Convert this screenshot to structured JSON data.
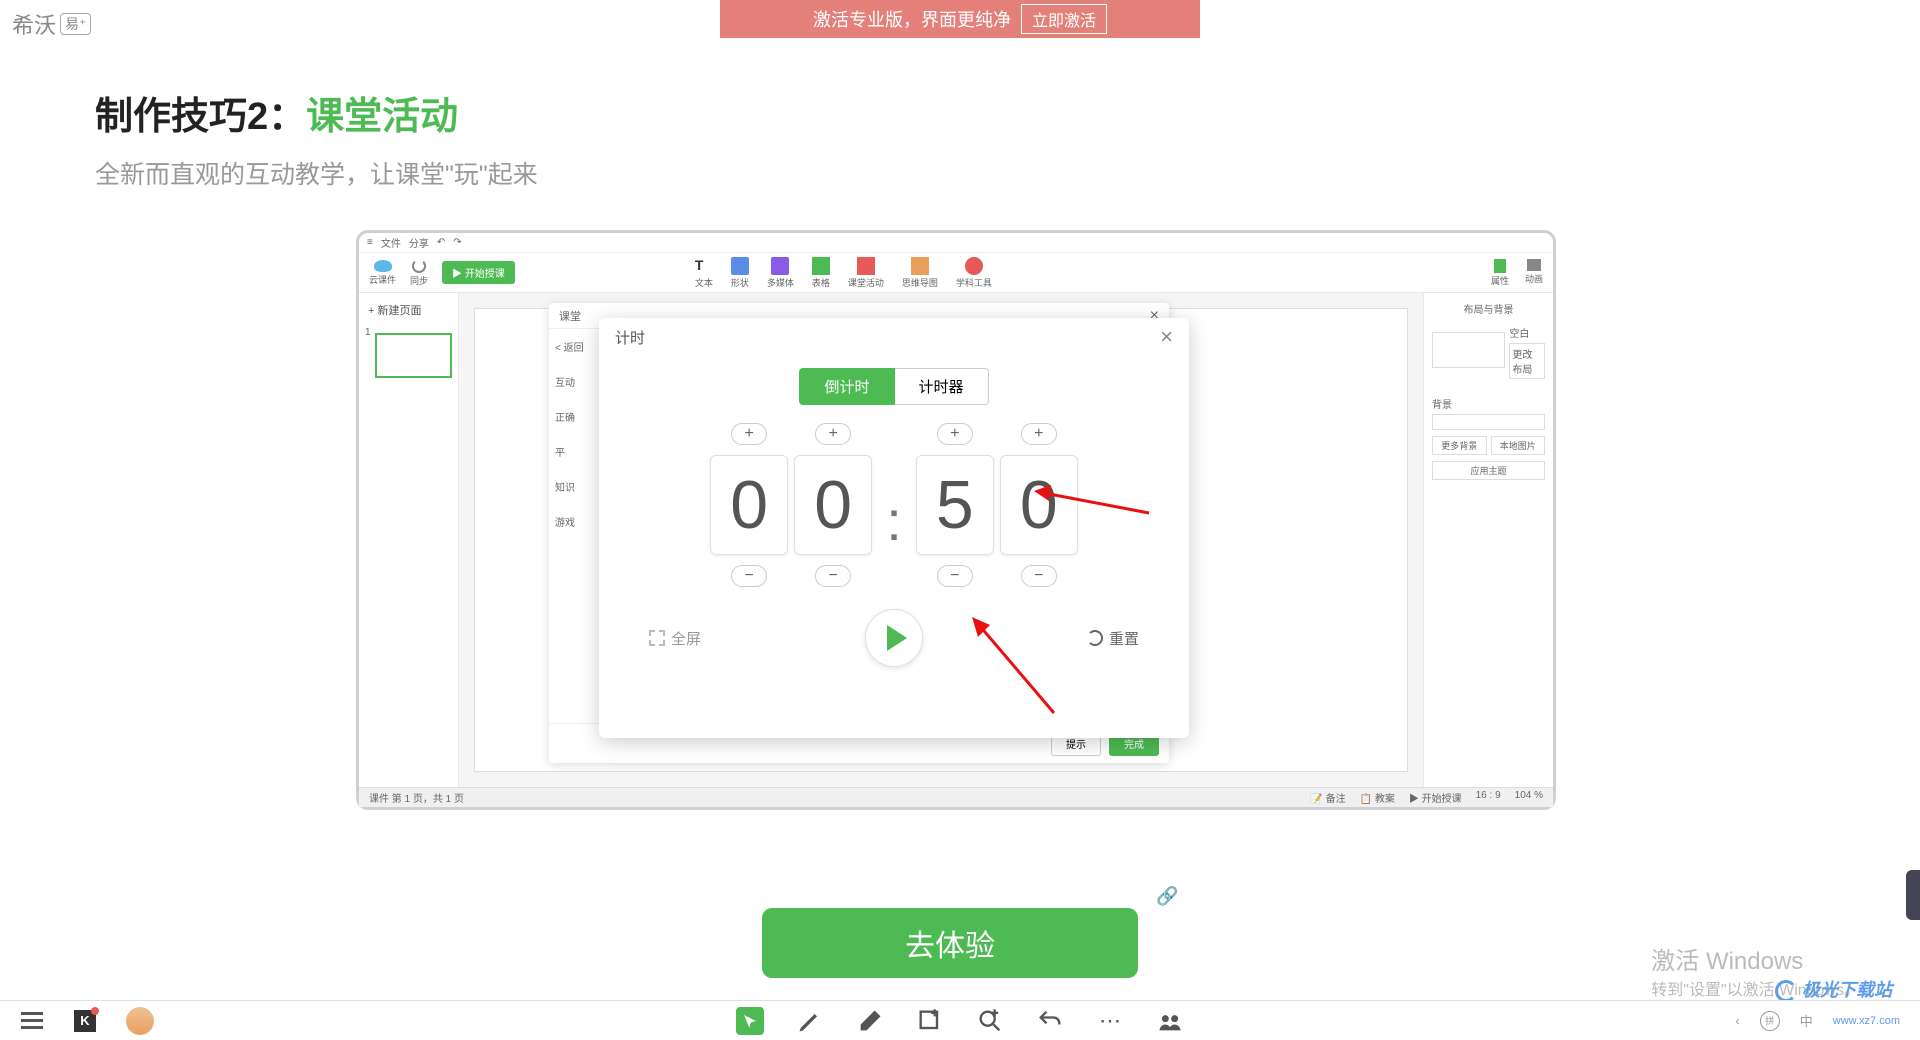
{
  "banner": {
    "text": "激活专业版，界面更纯净",
    "button": "立即激活"
  },
  "logo": {
    "text": "希沃",
    "badge": "易⁺"
  },
  "title": {
    "prefix": "制作技巧2：",
    "highlight": "课堂活动"
  },
  "subtitle": "全新而直观的互动教学，让课堂\"玩\"起来",
  "app": {
    "topbar": {
      "file": "文件",
      "share": "分享"
    },
    "toolbar": {
      "cloud": "云课件",
      "sync": "同步",
      "play": "开始授课",
      "text": "文本",
      "shape": "形状",
      "media": "多媒体",
      "table": "表格",
      "activity": "课堂活动",
      "mindmap": "思维导图",
      "subject": "学科工具",
      "props": "属性",
      "anim": "动画"
    },
    "slides": {
      "new": "+ 新建页面",
      "num": "1"
    },
    "props": {
      "title": "布局与背景",
      "blank": "空白",
      "moreLayout": "更改布局",
      "bg": "背景",
      "moreBg": "更多背景",
      "localImg": "本地图片",
      "applyTheme": "应用主题"
    },
    "status": {
      "page": "课件 第 1 页，共 1 页",
      "remark": "备注",
      "teach": "教案",
      "start": "开始授课",
      "ratio": "16 : 9",
      "zoom": "104 %"
    }
  },
  "activityDialog": {
    "title": "课堂",
    "back": "< 返回",
    "side": {
      "interact": "互动",
      "correct": "正确",
      "sub": "平",
      "knowledge": "知识",
      "game": "游戏"
    },
    "footer": {
      "hint": "提示",
      "done": "完成"
    }
  },
  "timer": {
    "title": "计时",
    "tabs": {
      "countdown": "倒计时",
      "stopwatch": "计时器"
    },
    "digits": [
      "0",
      "0",
      "5",
      "0"
    ],
    "fullscreen": "全屏",
    "reset": "重置"
  },
  "cta": "去体验",
  "winActivate": {
    "line1": "激活 Windows",
    "line2": "转到\"设置\"以激活 Windows。"
  },
  "watermark": "极光下载站",
  "bottomBar": {
    "ime": "中",
    "www": "www.xz7.com"
  }
}
